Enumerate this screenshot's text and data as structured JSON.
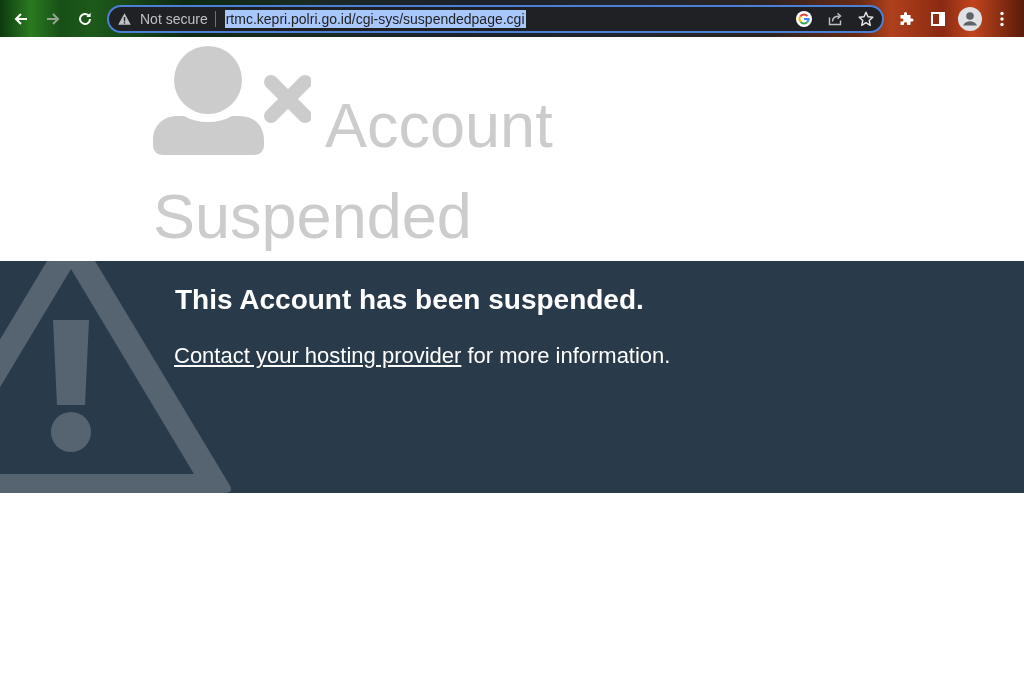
{
  "browser": {
    "nav_buttons": [
      {
        "kind": "back",
        "disabled": false
      },
      {
        "kind": "forward",
        "disabled": true
      },
      {
        "kind": "reload",
        "disabled": false
      }
    ],
    "address_bar": {
      "security_label": "Not secure",
      "url": "rtmc.kepri.polri.go.id/cgi-sys/suspendedpage.cgi",
      "url_selected": true
    }
  },
  "page": {
    "title_lines": [
      "Account",
      "Suspended"
    ],
    "notice": {
      "heading": "This Account has been suspended.",
      "link": "Contact your hosting provider",
      "text": "for more information."
    }
  }
}
